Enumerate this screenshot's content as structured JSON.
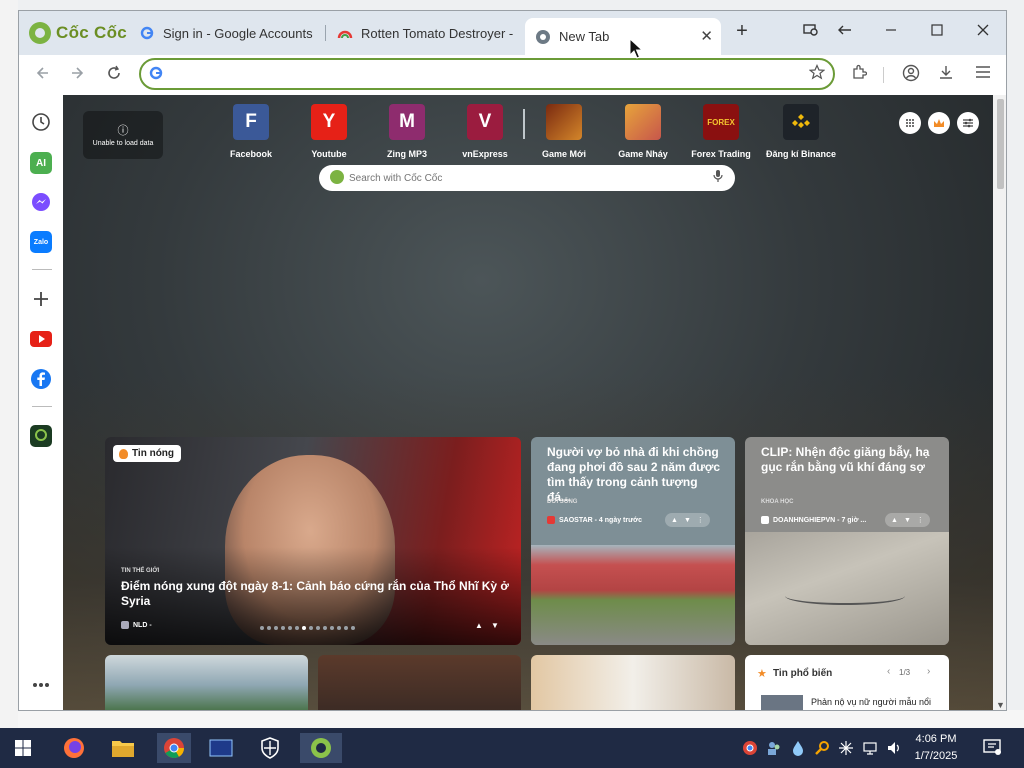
{
  "browser": {
    "brand_text": "Cốc Cốc",
    "tabs": [
      {
        "title": "Sign in - Google Accounts",
        "icon": "google-g-icon"
      },
      {
        "title": "Rotten Tomato Destroyer -",
        "icon": "rainbow-icon"
      },
      {
        "title": "New Tab",
        "icon": "coccoc-icon",
        "active": true
      }
    ],
    "new_tab_symbol": "+",
    "close_symbol": "✕",
    "omnibox_value": "",
    "accent_color": "#6b9b37"
  },
  "new_tab": {
    "load_error": "Unable to load data",
    "speed_dial": [
      {
        "letter": "F",
        "label": "Facebook",
        "color": "#3b5998"
      },
      {
        "letter": "Y",
        "label": "Youtube",
        "color": "#e62117"
      },
      {
        "letter": "M",
        "label": "Zing MP3",
        "color": "#8e2c6e"
      },
      {
        "letter": "V",
        "label": "vnExpress",
        "color": "#9b1c3f"
      },
      {
        "letter": "",
        "label": "Game Mới",
        "color": "#7a2a10"
      },
      {
        "letter": "",
        "label": "Game Nháy",
        "color": "#c7564b"
      },
      {
        "letter": "FOREX",
        "label": "Forex Trading",
        "color": "#8a1010"
      },
      {
        "letter": "",
        "label": "Đăng kí Binance",
        "color": "#1e2329"
      }
    ],
    "search_placeholder": "Search with Cốc Cốc",
    "featured": {
      "badge": "Tin nóng",
      "category": "TIN THẾ GIỚI",
      "headline": "Điểm nóng xung đột ngày 8-1: Cảnh báo cứng rắn của Thổ Nhĩ Kỳ ở Syria",
      "source": "NLD -"
    },
    "card2": {
      "headline": "Người vợ bỏ nhà đi khi chồng đang phơi đồ sau 2 năm được tìm thấy trong cảnh tượng đá...",
      "category": "ĐỜI SỐNG",
      "source": "SAOSTAR - 4 ngày trước"
    },
    "card3": {
      "headline": "CLIP: Nhện độc giăng bẫy, hạ gục rắn bằng vũ khí đáng sợ",
      "category": "KHOA HỌC",
      "source": "DOANHNGHIEPVN - 7 giờ ..."
    },
    "popular": {
      "title": "Tin phổ biến",
      "page": "1/3",
      "first_item": "Phản nộ vụ nữ người mẫu nổi"
    }
  },
  "taskbar": {
    "time": "4:06 PM",
    "date": "1/7/2025"
  }
}
